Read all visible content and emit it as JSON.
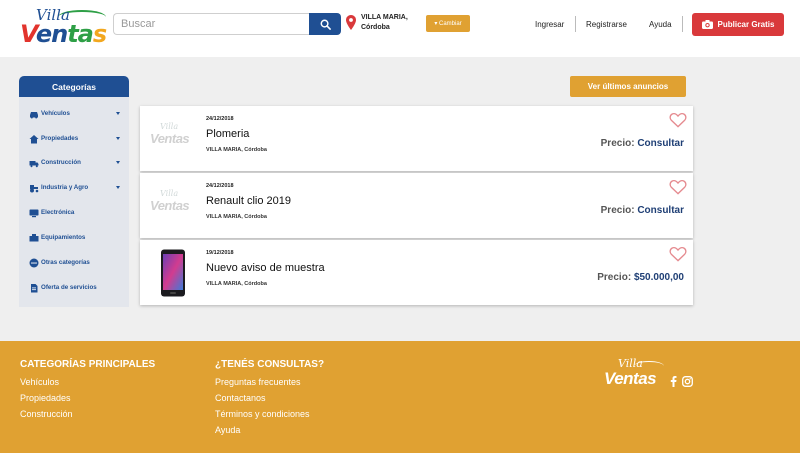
{
  "brand": {
    "logo_top": "Villa",
    "logo_bottom_parts": [
      "V",
      "en",
      "ta",
      "s"
    ],
    "colors": {
      "blue": "#1f4f93",
      "red": "#e2342d",
      "green": "#2e9f46",
      "orange": "#e0a132"
    }
  },
  "header": {
    "search_placeholder": "Buscar",
    "location_city": "VILLA MARIA,",
    "location_province": "Córdoba",
    "change_label": "▾ Cambiar",
    "nav": {
      "login": "Ingresar",
      "register": "Registrarse",
      "help": "Ayuda"
    },
    "publish_label": "Publicar Gratis"
  },
  "sidebar": {
    "title": "Categorías",
    "items": [
      {
        "label": "Vehículos",
        "icon": "car-icon",
        "has_submenu": true
      },
      {
        "label": "Propiedades",
        "icon": "house-icon",
        "has_submenu": true
      },
      {
        "label": "Construcción",
        "icon": "truck-icon",
        "has_submenu": true
      },
      {
        "label": "Industria y Agro",
        "icon": "tractor-icon",
        "has_submenu": true
      },
      {
        "label": "Electrónica",
        "icon": "tv-icon",
        "has_submenu": false
      },
      {
        "label": "Equipamientos",
        "icon": "equipment-icon",
        "has_submenu": false
      },
      {
        "label": "Otras categorías",
        "icon": "dots-icon",
        "has_submenu": false
      },
      {
        "label": "Oferta de servicios",
        "icon": "services-icon",
        "has_submenu": false
      }
    ]
  },
  "main": {
    "latest_button": "Ver últimos anuncios",
    "listings": [
      {
        "date": "24/12/2018",
        "title": "Plomeria",
        "location": "VILLA MARIA, Córdoba",
        "price_label": "Precio:",
        "price_value": "Consultar",
        "thumb": "placeholder-logo"
      },
      {
        "date": "24/12/2018",
        "title": "Renault clio 2019",
        "location": "VILLA MARIA, Córdoba",
        "price_label": "Precio:",
        "price_value": "Consultar",
        "thumb": "placeholder-logo"
      },
      {
        "date": "19/12/2018",
        "title": "Nuevo aviso de muestra",
        "location": "VILLA MARIA, Córdoba",
        "price_label": "Precio:",
        "price_value": "$50.000,00",
        "thumb": "phone-photo"
      }
    ]
  },
  "footer": {
    "col1": {
      "title": "CATEGORÍAS PRINCIPALES",
      "links": [
        "Vehículos",
        "Propiedades",
        "Construcción"
      ]
    },
    "col2": {
      "title": "¿TENÉS CONSULTAS?",
      "links": [
        "Preguntas frecuentes",
        "Contactanos",
        "Términos y condiciones",
        "Ayuda"
      ]
    },
    "logo_top": "Villa",
    "logo_bottom": "Ventas",
    "social": [
      "facebook-icon",
      "instagram-icon"
    ]
  }
}
